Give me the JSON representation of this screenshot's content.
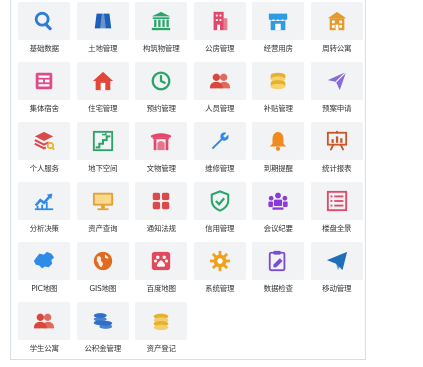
{
  "apps": [
    {
      "label": "基础数据",
      "icon": "search-icon",
      "color": "#2a7fd4"
    },
    {
      "label": "土地管理",
      "icon": "map-book-icon",
      "color": "#1d5fb8"
    },
    {
      "label": "构筑物管理",
      "icon": "building-columns-icon",
      "color": "#2aa56a"
    },
    {
      "label": "公房管理",
      "icon": "office-building-icon",
      "color": "#e04a6a"
    },
    {
      "label": "经营用房",
      "icon": "storefront-icon",
      "color": "#2e9be6"
    },
    {
      "label": "周转公寓",
      "icon": "apartment-icon",
      "color": "#e69a2e"
    },
    {
      "label": "集体宿舍",
      "icon": "dormitory-icon",
      "color": "#e04a8a"
    },
    {
      "label": "住宅管理",
      "icon": "house-icon",
      "color": "#e0483a"
    },
    {
      "label": "预约管理",
      "icon": "clock-icon",
      "color": "#2aa56a"
    },
    {
      "label": "人员管理",
      "icon": "people-icon",
      "color": "#d9483a"
    },
    {
      "label": "补贴管理",
      "icon": "coins-icon",
      "color": "#e6b12e"
    },
    {
      "label": "预案申请",
      "icon": "paper-plane-icon",
      "color": "#8a6ad9"
    },
    {
      "label": "个人服务",
      "icon": "layers-user-icon",
      "color": "#d94a4a"
    },
    {
      "label": "地下空间",
      "icon": "stairs-icon",
      "color": "#2aa56a"
    },
    {
      "label": "文物管理",
      "icon": "pavilion-icon",
      "color": "#e04a6a"
    },
    {
      "label": "维修管理",
      "icon": "wrench-icon",
      "color": "#2e8be6"
    },
    {
      "label": "到期提醒",
      "icon": "bell-icon",
      "color": "#f08a1e"
    },
    {
      "label": "统计报表",
      "icon": "presentation-chart-icon",
      "color": "#c9582a"
    },
    {
      "label": "分析决策",
      "icon": "trend-chart-icon",
      "color": "#2e8be6"
    },
    {
      "label": "资产查询",
      "icon": "monitor-icon",
      "color": "#e6a12e"
    },
    {
      "label": "通知法规",
      "icon": "grid-apps-icon",
      "color": "#d94a4a"
    },
    {
      "label": "信用管理",
      "icon": "shield-check-icon",
      "color": "#2aa56a"
    },
    {
      "label": "会议纪要",
      "icon": "meeting-icon",
      "color": "#8a3ad9"
    },
    {
      "label": "楼盘全景",
      "icon": "list-panel-icon",
      "color": "#e04a6a"
    },
    {
      "label": "PIC地图",
      "icon": "china-map-icon",
      "color": "#2e8be6"
    },
    {
      "label": "GIS地图",
      "icon": "globe-icon",
      "color": "#e06a1e"
    },
    {
      "label": "百度地图",
      "icon": "baidu-paw-icon",
      "color": "#e04a5a"
    },
    {
      "label": "系统管理",
      "icon": "gear-icon",
      "color": "#f0a01e"
    },
    {
      "label": "数据检查",
      "icon": "clipboard-edit-icon",
      "color": "#7a4ad9"
    },
    {
      "label": "移动管理",
      "icon": "send-icon",
      "color": "#1d6fb8"
    },
    {
      "label": "学生公寓",
      "icon": "people-icon",
      "color": "#d9483a"
    },
    {
      "label": "公积金管理",
      "icon": "coins-stack-icon",
      "color": "#2e6fc9"
    },
    {
      "label": "资产登记",
      "icon": "coins-gold-icon",
      "color": "#e6b12e"
    }
  ]
}
